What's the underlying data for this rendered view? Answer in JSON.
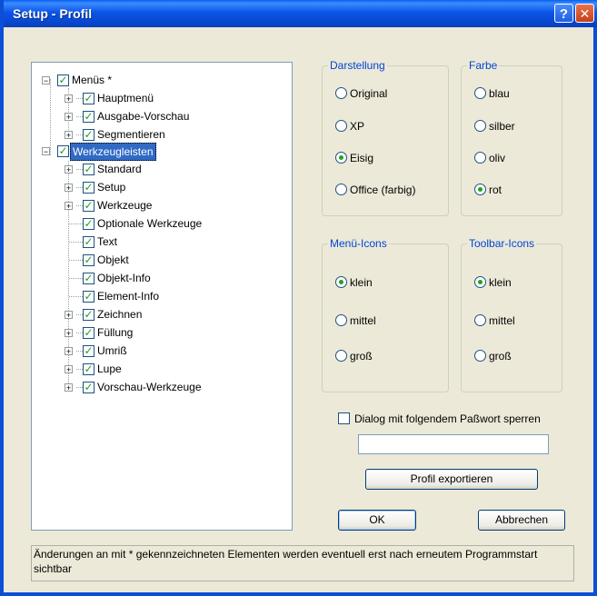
{
  "window": {
    "title": "Setup - Profil",
    "help_label": "?",
    "close_label": "✕"
  },
  "tree": {
    "root_menus": {
      "label": "Menüs *",
      "expander": "−"
    },
    "menus_children": [
      {
        "label": "Hauptmenü",
        "expander": "+"
      },
      {
        "label": "Ausgabe-Vorschau",
        "expander": "+"
      },
      {
        "label": "Segmentieren",
        "expander": "+"
      }
    ],
    "root_toolbars": {
      "label": "Werkzeugleisten",
      "expander": "−"
    },
    "toolbar_children": [
      {
        "label": "Standard",
        "expander": "+"
      },
      {
        "label": "Setup",
        "expander": "+"
      },
      {
        "label": "Werkzeuge",
        "expander": "+"
      },
      {
        "label": "Optionale Werkzeuge",
        "expander": ""
      },
      {
        "label": "Text",
        "expander": ""
      },
      {
        "label": "Objekt",
        "expander": ""
      },
      {
        "label": "Objekt-Info",
        "expander": ""
      },
      {
        "label": "Element-Info",
        "expander": ""
      },
      {
        "label": "Zeichnen",
        "expander": "+"
      },
      {
        "label": "Füllung",
        "expander": "+"
      },
      {
        "label": "Umriß",
        "expander": "+"
      },
      {
        "label": "Lupe",
        "expander": "+"
      },
      {
        "label": "Vorschau-Werkzeuge",
        "expander": "+"
      }
    ],
    "check_mark": "✓"
  },
  "darstellung": {
    "title": "Darstellung",
    "options": [
      "Original",
      "XP",
      "Eisig",
      "Office (farbig)"
    ],
    "selected": "Eisig"
  },
  "farbe": {
    "title": "Farbe",
    "options": [
      "blau",
      "silber",
      "oliv",
      "rot"
    ],
    "selected": "rot"
  },
  "menu_icons": {
    "title": "Menü-Icons",
    "options": [
      "klein",
      "mittel",
      "groß"
    ],
    "selected": "klein"
  },
  "toolbar_icons": {
    "title": "Toolbar-Icons",
    "options": [
      "klein",
      "mittel",
      "groß"
    ],
    "selected": "klein"
  },
  "password": {
    "checkbox_label": "Dialog mit folgendem Paßwort sperren",
    "checked": false,
    "value": ""
  },
  "buttons": {
    "export": "Profil exportieren",
    "ok": "OK",
    "cancel": "Abbrechen"
  },
  "status_text": "Änderungen an mit * gekennzeichneten Elementen werden eventuell erst nach erneutem Programmstart sichtbar",
  "colors": {
    "titlebar": "#0A5FF0",
    "dialog_bg": "#ECE9D8",
    "group_title": "#0046D5",
    "selection": "#316AC5",
    "check_green": "#21A121"
  }
}
